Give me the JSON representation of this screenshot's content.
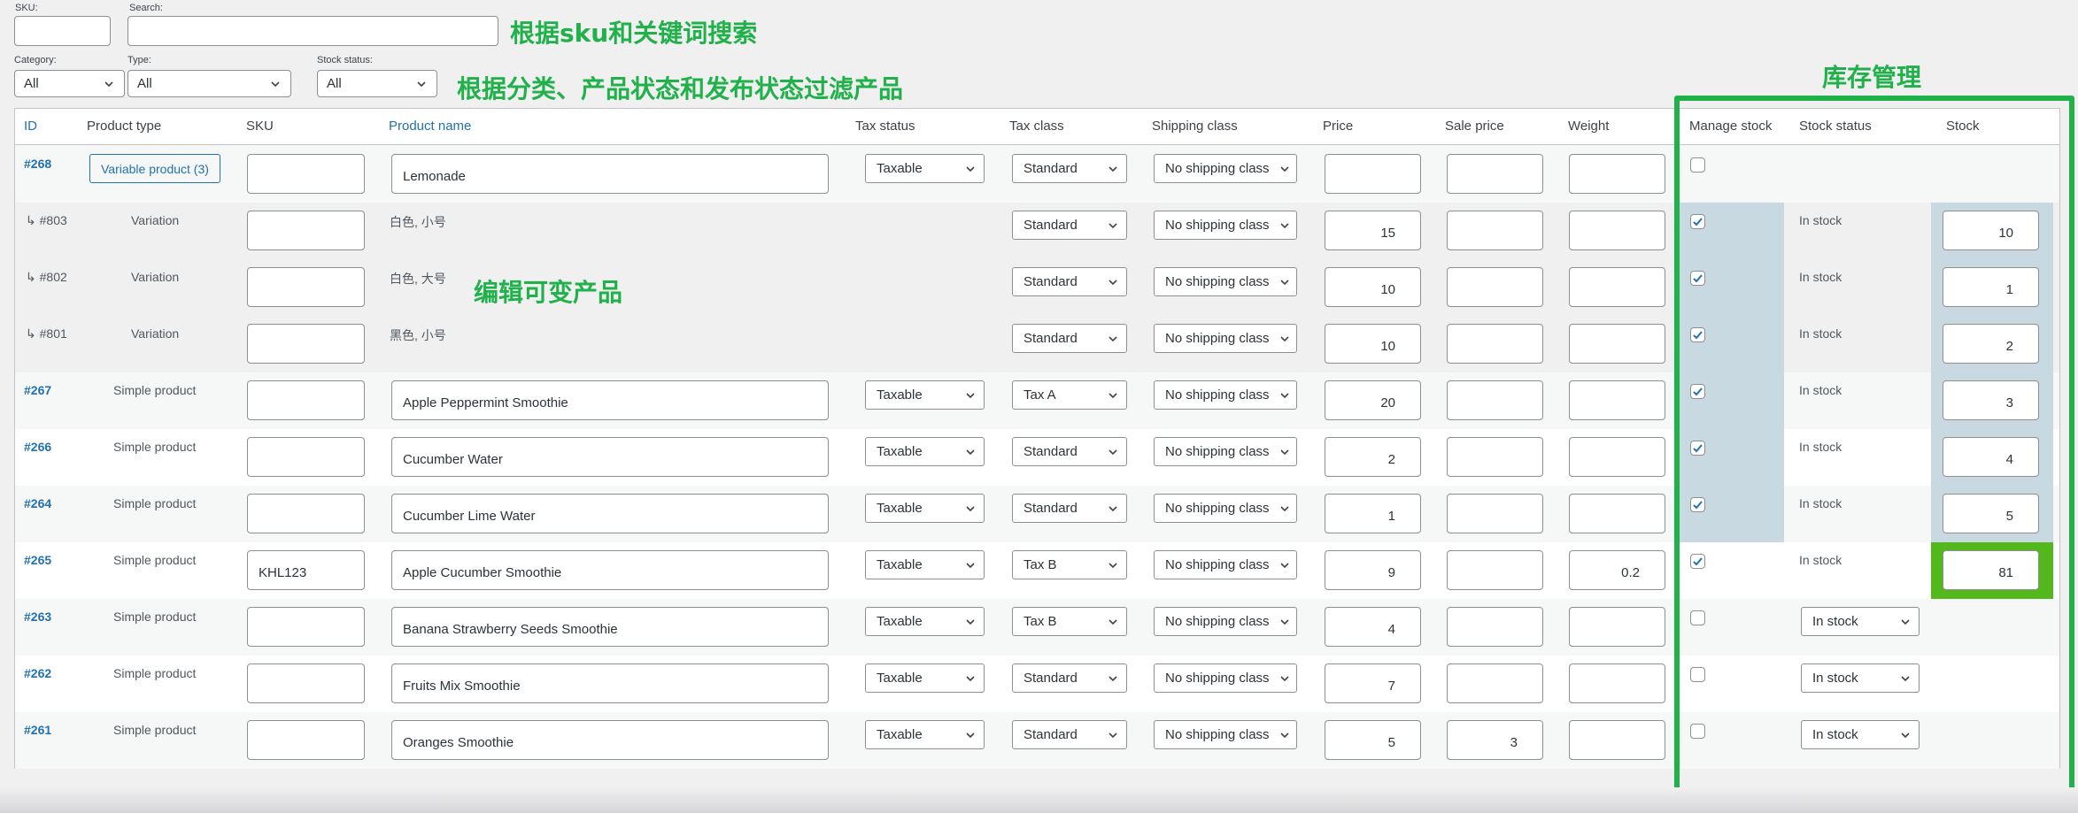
{
  "filters": {
    "sku_label": "SKU:",
    "sku_value": "",
    "search_label": "Search:",
    "search_value": "",
    "category_label": "Category:",
    "category_value": "All",
    "type_label": "Type:",
    "type_value": "All",
    "stock_status_label": "Stock status:",
    "stock_status_value": "All"
  },
  "annotations": {
    "search": "根据sku和关键词搜索",
    "filter": "根据分类、产品状态和发布状态过滤产品",
    "variable": "编辑可变产品",
    "stock": "库存管理"
  },
  "colors": {
    "annotation_green": "#21b14a",
    "link_blue": "#2271b1",
    "highlight_blue": "#c8d9e2",
    "highlight_green": "#52b81b"
  },
  "columns": {
    "id": "ID",
    "product_type": "Product type",
    "sku": "SKU",
    "product_name": "Product name",
    "tax_status": "Tax status",
    "tax_class": "Tax class",
    "shipping_class": "Shipping class",
    "price": "Price",
    "sale_price": "Sale price",
    "weight": "Weight",
    "manage_stock": "Manage stock",
    "stock_status": "Stock status",
    "stock": "Stock"
  },
  "rows": [
    {
      "id": "#268",
      "type": "Variable product (3)",
      "is_variable": true,
      "sku": "",
      "name": "Lemonade",
      "tax_status": "Taxable",
      "tax_class": "Standard",
      "shipping": "No shipping class",
      "price": "",
      "sale": "",
      "weight": "",
      "manage": false,
      "stock_status": "",
      "stock": ""
    },
    {
      "id": "↳ #803",
      "type": "Variation",
      "is_variation": true,
      "sku": "",
      "name": "白色, 小号",
      "tax_status": "",
      "tax_class": "Standard",
      "shipping": "No shipping class",
      "price": "15",
      "sale": "",
      "weight": "",
      "manage": true,
      "stock_status": "In stock",
      "stock": "10"
    },
    {
      "id": "↳ #802",
      "type": "Variation",
      "is_variation": true,
      "sku": "",
      "name": "白色, 大号",
      "tax_status": "",
      "tax_class": "Standard",
      "shipping": "No shipping class",
      "price": "10",
      "sale": "",
      "weight": "",
      "manage": true,
      "stock_status": "In stock",
      "stock": "1"
    },
    {
      "id": "↳ #801",
      "type": "Variation",
      "is_variation": true,
      "sku": "",
      "name": "黑色, 小号",
      "tax_status": "",
      "tax_class": "Standard",
      "shipping": "No shipping class",
      "price": "10",
      "sale": "",
      "weight": "",
      "manage": true,
      "stock_status": "In stock",
      "stock": "2"
    },
    {
      "id": "#267",
      "type": "Simple product",
      "sku": "",
      "name": "Apple Peppermint Smoothie",
      "tax_status": "Taxable",
      "tax_class": "Tax A",
      "shipping": "No shipping class",
      "price": "20",
      "sale": "",
      "weight": "",
      "manage": true,
      "stock_status": "In stock",
      "stock": "3"
    },
    {
      "id": "#266",
      "type": "Simple product",
      "sku": "",
      "name": "Cucumber Water",
      "tax_status": "Taxable",
      "tax_class": "Standard",
      "shipping": "No shipping class",
      "price": "2",
      "sale": "",
      "weight": "",
      "manage": true,
      "stock_status": "In stock",
      "stock": "4"
    },
    {
      "id": "#264",
      "type": "Simple product",
      "sku": "",
      "name": "Cucumber Lime Water",
      "tax_status": "Taxable",
      "tax_class": "Standard",
      "shipping": "No shipping class",
      "price": "1",
      "sale": "",
      "weight": "",
      "manage": true,
      "stock_status": "In stock",
      "stock": "5"
    },
    {
      "id": "#265",
      "type": "Simple product",
      "sku": "KHL123",
      "name": "Apple Cucumber Smoothie",
      "tax_status": "Taxable",
      "tax_class": "Tax B",
      "shipping": "No shipping class",
      "price": "9",
      "sale": "",
      "weight": "0.2",
      "manage": true,
      "stock_status": "In stock",
      "stock": "81"
    },
    {
      "id": "#263",
      "type": "Simple product",
      "sku": "",
      "name": "Banana Strawberry Seeds Smoothie",
      "tax_status": "Taxable",
      "tax_class": "Tax B",
      "shipping": "No shipping class",
      "price": "4",
      "sale": "",
      "weight": "",
      "manage": false,
      "stock_status": "In stock",
      "stock_status_select": true,
      "stock": ""
    },
    {
      "id": "#262",
      "type": "Simple product",
      "sku": "",
      "name": "Fruits Mix Smoothie",
      "tax_status": "Taxable",
      "tax_class": "Standard",
      "shipping": "No shipping class",
      "price": "7",
      "sale": "",
      "weight": "",
      "manage": false,
      "stock_status": "In stock",
      "stock_status_select": true,
      "stock": ""
    },
    {
      "id": "#261",
      "type": "Simple product",
      "sku": "",
      "name": "Oranges Smoothie",
      "tax_status": "Taxable",
      "tax_class": "Standard",
      "shipping": "No shipping class",
      "price": "5",
      "sale": "3",
      "weight": "",
      "manage": false,
      "stock_status": "In stock",
      "stock_status_select": true,
      "stock": ""
    }
  ]
}
